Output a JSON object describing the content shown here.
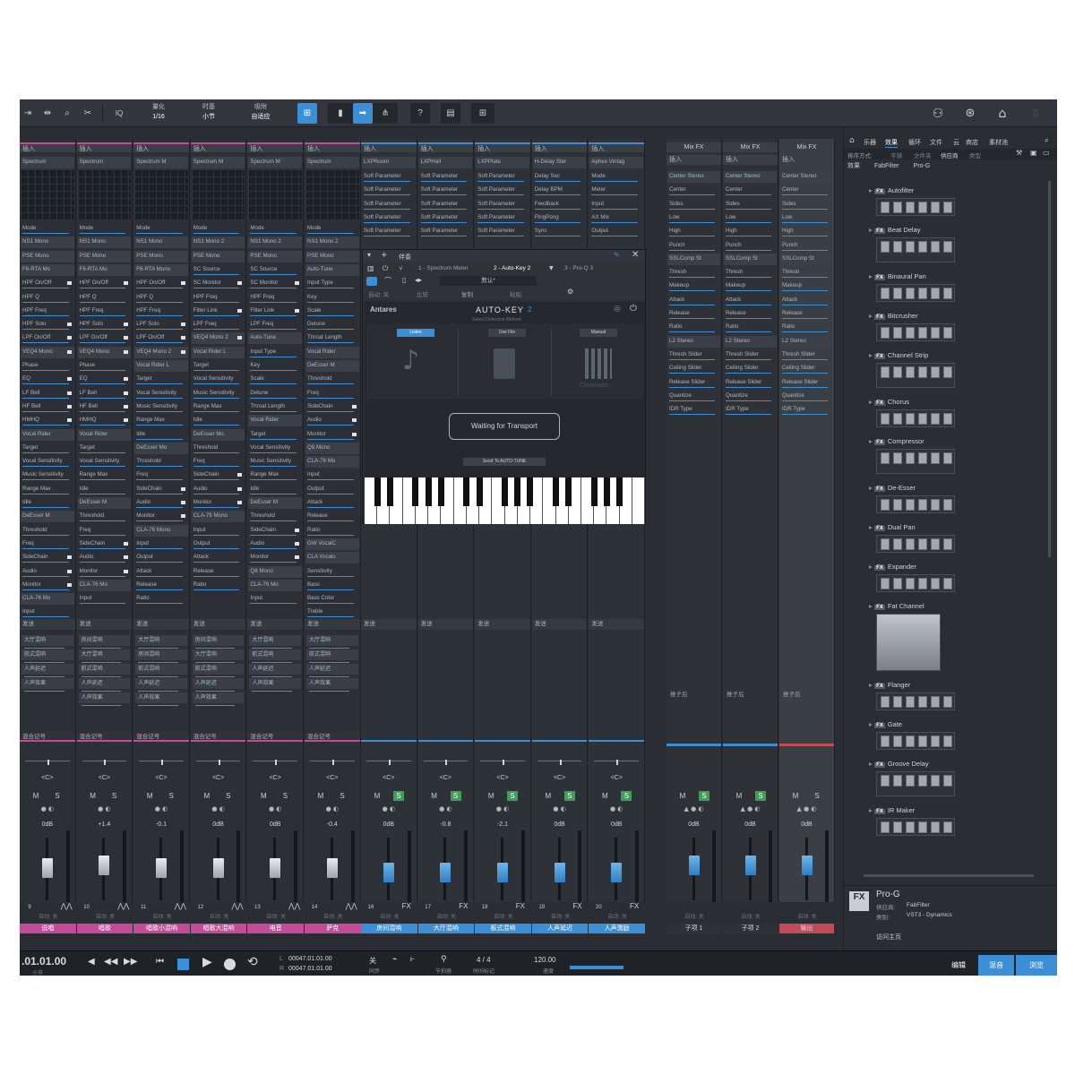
{
  "toolbar": {
    "snap": {
      "label1": "量化",
      "value1": "1/16",
      "label2": "时基",
      "value2": "小节",
      "label3": "吸附",
      "value3": "自适应"
    },
    "iq_label": "IQ",
    "help_label": "?",
    "icons": [
      "skip-icon",
      "range-icon",
      "zoom-icon",
      "scissors-icon",
      "iq-icon",
      "snap-icon",
      "cursor-icon",
      "arrow-icon",
      "split-icon",
      "help-icon",
      "film-icon",
      "grid-icon",
      "user-icon",
      "sync-icon",
      "home-icon",
      "page-icon"
    ]
  },
  "strips": [
    {
      "plugin": "Spectrum",
      "kind": "pink",
      "rows": [
        "Mode",
        "NS1 Mono",
        "PSE Mono",
        "F6-RTA Mo",
        "HPF On/Off",
        "HPF Q",
        "HPF Freq",
        "HPF Solo",
        "LPF On/Off",
        "VEQ4 Mono",
        "Phase",
        "EQ",
        "LF Bell",
        "HF Bell",
        "HMHQ",
        "Vocal Rider",
        "Target",
        "Vocal Sensitivity",
        "Music Sensitivity",
        "Range Max",
        "Idle",
        "DeEsser M",
        "Threshold",
        "Freq",
        "SideChain",
        "Audio",
        "Monitor",
        "CLA-76 Mo",
        "Input"
      ],
      "sends": [
        "大厅混响",
        "航式混响",
        "人声延迟",
        "人声效果"
      ],
      "db": "0dB",
      "num": "9",
      "name": "说唱",
      "fader": 0.55,
      "ms": [
        "M",
        "S"
      ]
    },
    {
      "plugin": "Spectrum",
      "kind": "pink",
      "rows": [
        "Mode",
        "NS1 Mono",
        "PSE Mono",
        "F6-RTA Mo",
        "HPF On/Off",
        "HPF Q",
        "HPF Freq",
        "HPF Solo",
        "LPF On/Off",
        "VEQ4 Mono",
        "Phase",
        "EQ",
        "LF Bell",
        "HF Bell",
        "HMHQ",
        "Vocal Rider",
        "Target",
        "Vocal Sensitivity",
        "Range Max",
        "Idle",
        "DeEsser M",
        "Threshold",
        "Freq",
        "SideChain",
        "Audio",
        "Monitor",
        "CLA-76 Mo",
        "Input"
      ],
      "sends": [
        "房间混响",
        "大厅混响",
        "航式混响",
        "人声延迟",
        "人声效果"
      ],
      "db": "+1.4",
      "num": "10",
      "name": "唱歌",
      "fader": 0.6,
      "ms": [
        "M",
        "S"
      ]
    },
    {
      "plugin": "Spectrum M",
      "kind": "pink",
      "rows": [
        "Mode",
        "NS1 Mono",
        "PSE Mono",
        "F6-RTA Mono",
        "HPF On/Off",
        "HPF Q",
        "HPF Freq",
        "LPF Solo",
        "LPF On/Off",
        "VEQ4 Mono 2",
        "Vocal Rider L",
        "Target",
        "Vocal Sensitivity",
        "Music Sensitivity",
        "Range Max",
        "Idle",
        "DeEsser Mo",
        "Threshold",
        "Freq",
        "SideChain",
        "Audio",
        "Monitor",
        "CLA-76 Mono",
        "Input",
        "Output",
        "Attack",
        "Release",
        "Ratio"
      ],
      "sends": [
        "大厅混响",
        "房间混响",
        "航式混响",
        "人声延迟",
        "人声效果"
      ],
      "db": "-0.1",
      "num": "11",
      "name": "唱歌小混响",
      "fader": 0.55,
      "ms": [
        "M",
        "S"
      ]
    },
    {
      "plugin": "Spectrum M",
      "kind": "pink",
      "rows": [
        "Mode",
        "NS1 Mono 2",
        "PSE Mono",
        "SC Source",
        "SC Monitor",
        "HPF Freq",
        "Filter Link",
        "LPF Freq",
        "VEQ4 Mono 2",
        "Vocal Rider L",
        "Target",
        "Vocal Sensitivity",
        "Music Sensitivity",
        "Range Max",
        "Idle",
        "DeEsser Mo",
        "Threshold",
        "Freq",
        "SideChain",
        "Audio",
        "Monitor",
        "CLA-76 Mono",
        "Input",
        "Output",
        "Attack",
        "Release",
        "Ratio"
      ],
      "sends": [
        "房间混响",
        "大厅混响",
        "航式混响",
        "人声延迟",
        "人声效果"
      ],
      "db": "0dB",
      "num": "12",
      "name": "唱歌大混响",
      "fader": 0.55,
      "ms": [
        "M",
        "S"
      ]
    },
    {
      "plugin": "Spectrum M",
      "kind": "pink",
      "rows": [
        "Mode",
        "NS1 Mono 2",
        "PSE Mono",
        "SC Source",
        "SC Monitor",
        "HPF Freq",
        "Filter Link",
        "LPF Freq",
        "Auto-Tune",
        "Input Type",
        "Key",
        "Scale",
        "Detune",
        "Throat Length",
        "Vocal Rider",
        "Target",
        "Vocal Sensitivity",
        "Music Sensitivity",
        "Range Max",
        "Idle",
        "DeEsser M",
        "Threshold",
        "SideChain",
        "Audio",
        "Monitor",
        "Q8 Mono",
        "CLA-76 Mo",
        "Input"
      ],
      "sends": [
        "大厅混响",
        "航式混响",
        "人声延迟",
        "人声效果"
      ],
      "db": "0dB",
      "num": "13",
      "name": "电音",
      "fader": 0.55,
      "ms": [
        "M",
        "S"
      ]
    },
    {
      "plugin": "Spectrum",
      "kind": "pink",
      "rows": [
        "Mode",
        "NS1 Mono 2",
        "PSE Mono",
        "Auto-Tune",
        "Input Type",
        "Key",
        "Scale",
        "Detune",
        "Throat Length",
        "Vocal Rider",
        "DeEsser M",
        "Threshold",
        "Freq",
        "SideChain",
        "Audio",
        "Monitor",
        "Q8 Mono",
        "CLA-76 Mo",
        "Input",
        "Output",
        "Attack",
        "Release",
        "Ratio",
        "GW VocalC",
        "CLA Vocals",
        "Sensitivity",
        "Bass",
        "Bass Color",
        "Treble"
      ],
      "sends": [
        "大厅混响",
        "航式混响",
        "人声延迟",
        "人声效果"
      ],
      "db": "-0.4",
      "num": "14",
      "name": "萨克",
      "fader": 0.55,
      "ms": [
        "M",
        "S"
      ]
    }
  ],
  "blue_strips": [
    {
      "plugin": "LXPRoom",
      "params": [
        "Soft Parameter",
        "Soft Parameter",
        "Soft Parameter",
        "Soft Parameter",
        "Soft Parameter"
      ],
      "db": "0dB",
      "num": "16",
      "name": "房间混响"
    },
    {
      "plugin": "LXPHall",
      "params": [
        "Soft Parameter",
        "Soft Parameter",
        "Soft Parameter",
        "Soft Parameter",
        "Soft Parameter"
      ],
      "db": "-0.8",
      "num": "17",
      "name": "大厅混响"
    },
    {
      "plugin": "LXPPlate",
      "params": [
        "Soft Parameter",
        "Soft Parameter",
        "Soft Parameter",
        "Soft Parameter",
        "Soft Parameter"
      ],
      "db": "-2.1",
      "num": "18",
      "name": "板式混响"
    },
    {
      "plugin": "H-Delay Ster",
      "params": [
        "Delay Sec",
        "Delay BPM",
        "Feedback",
        "PingPong",
        "Sync"
      ],
      "db": "0dB",
      "num": "19",
      "name": "人声延迟"
    },
    {
      "plugin": "Aphex Vintag",
      "params": [
        "Mode",
        "Meter",
        "Input",
        "AX Mix",
        "Output"
      ],
      "db": "0dB",
      "num": "20",
      "name": "人声激励"
    }
  ],
  "fx_strips": [
    {
      "header": "Mix FX",
      "rows": [
        "Center Stereo",
        "Center",
        "Sides",
        "Low",
        "High",
        "Punch",
        "SSLComp St",
        "Thresh",
        "Makeup",
        "Attack",
        "Release",
        "Ratio",
        "L2 Stereo",
        "Thresh Slider",
        "Ceiling Slider",
        "Release Slider",
        "Quantize",
        "IDR Type"
      ],
      "post": "推子后",
      "db": "0dB",
      "name": "子项 1",
      "accent": "#3a8fd6"
    },
    {
      "header": "Mix FX",
      "rows": [
        "Center Stereo",
        "Center",
        "Sides",
        "Low",
        "High",
        "Punch",
        "SSLComp St",
        "Thresh",
        "Makeup",
        "Attack",
        "Release",
        "Ratio",
        "L2 Stereo",
        "Thresh Slider",
        "Ceiling Slider",
        "Release Slider",
        "Quantize",
        "IDR Type"
      ],
      "post": "推子后",
      "db": "0dB",
      "name": "子项 2",
      "accent": "#3a8fd6"
    },
    {
      "header": "Mix FX",
      "rows": [
        "Center Stereo",
        "Center",
        "Sides",
        "Low",
        "High",
        "Punch",
        "SSLComp St",
        "Thresh",
        "Makeup",
        "Attack",
        "Release",
        "Ratio",
        "L2 Stereo",
        "Thresh Slider",
        "Ceiling Slider",
        "Release Slider",
        "Quantize",
        "IDR Type"
      ],
      "post": "推子后",
      "db": "0dB",
      "name": "输出",
      "accent": "#c24b5a"
    }
  ],
  "common": {
    "insert_label": "插入",
    "send_label": "发送",
    "mix_label": "混合记号",
    "pan": "<C>",
    "foot": "自动: 关"
  },
  "plugin_window": {
    "title": "伴奏",
    "tabs": [
      "1 - Spectrum Meter",
      "2 - Auto-Key 2",
      "3 - Pro-Q 3"
    ],
    "preset": "默认*",
    "row_labels": [
      "自动: 关",
      "比较",
      "复制",
      "粘贴"
    ],
    "brand": "Antares",
    "product": "AUTO-KEY",
    "version": "2",
    "sub": "Select Detection Method",
    "modes": [
      "Listen",
      "Use File",
      "Manual"
    ],
    "chromatic": "Chromatic -",
    "status": "Waiting for Transport",
    "send_btn": "Send To AUTO-TUNE"
  },
  "browser": {
    "tabs": [
      "乐器",
      "效果",
      "循环",
      "文件",
      "云",
      "商店",
      "素材池"
    ],
    "sort_label": "排序方式:",
    "sort_opts": [
      "平铺",
      "文件夹",
      "供应商",
      "类型"
    ],
    "crumbs": [
      "效果",
      "FabFilter",
      "Pro-G"
    ],
    "items": [
      "Autofilter",
      "Beat Delay",
      "Binaural Pan",
      "Bitcrusher",
      "Channel Strip",
      "Chorus",
      "Compressor",
      "De-Esser",
      "Dual Pan",
      "Expander",
      "Fat Channel",
      "Flanger",
      "Gate",
      "Groove Delay",
      "IR Maker"
    ],
    "info": {
      "fx": "FX",
      "name": "Pro-G",
      "vendor_label": "供应商:",
      "vendor": "FabFilter",
      "cat_label": "类别:",
      "category": "VST3 - Dynamics",
      "link": "访问主页"
    }
  },
  "transport": {
    "position": ".01.01.00",
    "position_unit": "小节",
    "loop_l": "00047.01.01.00",
    "loop_r": "00047.01.01.00",
    "l_label": "L",
    "r_label": "R",
    "sync_label": "关",
    "sync_sub": "同步",
    "metronome": "节拍器",
    "sig": "4 / 4",
    "sig_label": "时间标记",
    "tempo": "120.00",
    "tempo_label": "速度",
    "nav": [
      "编辑",
      "混音",
      "浏览"
    ]
  },
  "colors": {
    "accent": "#3a8fd6",
    "pink": "#c24b9a",
    "mute_on": "#3f9e55",
    "bg": "#2a2e34"
  }
}
